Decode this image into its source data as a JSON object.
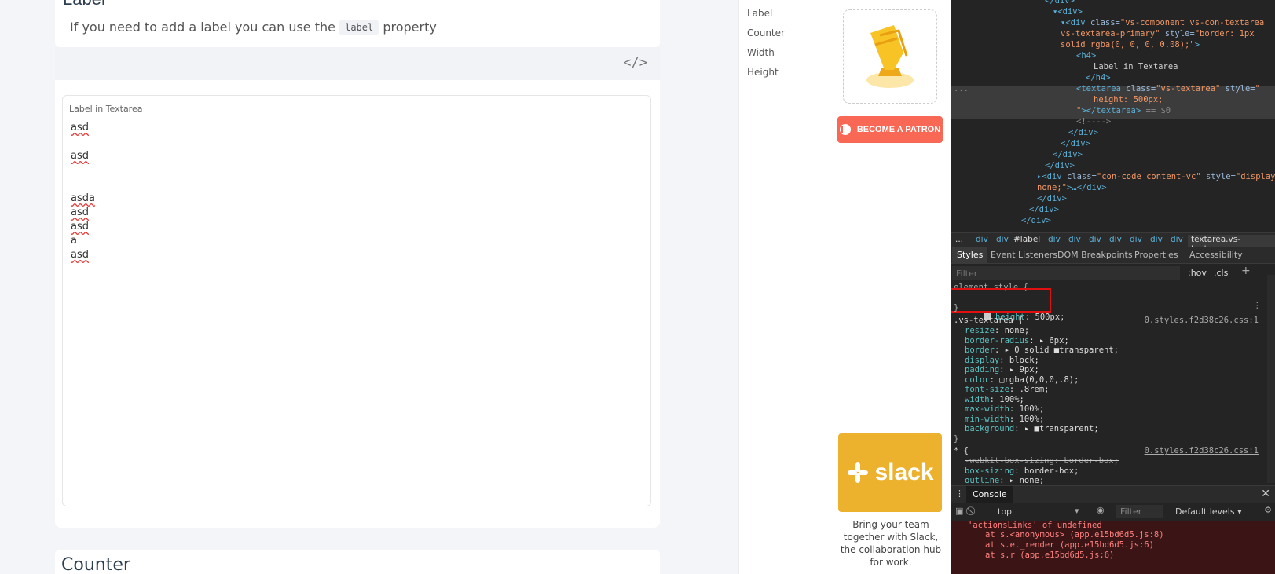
{
  "doc": {
    "section_title_top": "Label",
    "intro_prefix": "If you need to add a label you can use the",
    "intro_code": "label",
    "intro_suffix": "property",
    "code_toggle": "</>",
    "textarea_label": "Label in Textarea",
    "textarea_lines": [
      "asd",
      "",
      "asd",
      "",
      "",
      "asda",
      "asd",
      "asd",
      "a",
      "asd"
    ],
    "next_section_title": "Counter"
  },
  "toc": {
    "items": [
      "Label",
      "Counter",
      "Width",
      "Height"
    ]
  },
  "sponsor": {
    "patron_label": "BECOME A PATRON",
    "slack_label": "slack",
    "slack_text": "Bring your team together with Slack, the collaboration hub for work."
  },
  "devtools": {
    "crumbs": [
      "...",
      "div",
      "div",
      "#label",
      "div",
      "div",
      "div",
      "div",
      "div",
      "div",
      "div",
      "textarea.vs-textarea"
    ],
    "tabs": [
      "Styles",
      "Event Listeners",
      "DOM Breakpoints",
      "Properties",
      "Accessibility"
    ],
    "filter_placeholder": "Filter",
    "hov_label": ":hov",
    "cls_label": ".cls",
    "plus_label": "+",
    "element_style_header": "element.style {",
    "element_style_prop": "height",
    "element_style_value": "500px;",
    "rule1_selector": ".vs-textarea {",
    "rule1_source": "0.styles.f2d38c26.css:1",
    "rule1_props": [
      [
        "resize",
        "none;"
      ],
      [
        "border-radius",
        "▸ 6px;"
      ],
      [
        "border",
        "▸ 0 solid ■transparent;"
      ],
      [
        "display",
        "block;"
      ],
      [
        "padding",
        "▸ 9px;"
      ],
      [
        "color",
        "□rgba(0,0,0,.8);"
      ],
      [
        "font-size",
        ".8rem;"
      ],
      [
        "width",
        "100%;"
      ],
      [
        "max-width",
        "100%;"
      ],
      [
        "min-width",
        "100%;"
      ],
      [
        "background",
        "▸ ■transparent;"
      ]
    ],
    "rule2_selector": "* {",
    "rule2_source": "0.styles.f2d38c26.css:1",
    "rule2_props": [
      [
        "-webkit-box-sizing",
        "border-box;"
      ],
      [
        "box-sizing",
        "border-box;"
      ],
      [
        "outline",
        "▸ none;"
      ]
    ],
    "close_brace": "}",
    "console_tab": "Console",
    "console_context": "top",
    "console_filter": "Filter",
    "console_levels": "Default levels ▾",
    "console_lines": [
      "'actionsLinks' of undefined",
      "at s.<anonymous> (app.e15bd6d5.js:8)",
      "at s.e._render (app.e15bd6d5.js:6)",
      "at s.r (app.e15bd6d5.js:6)"
    ]
  }
}
